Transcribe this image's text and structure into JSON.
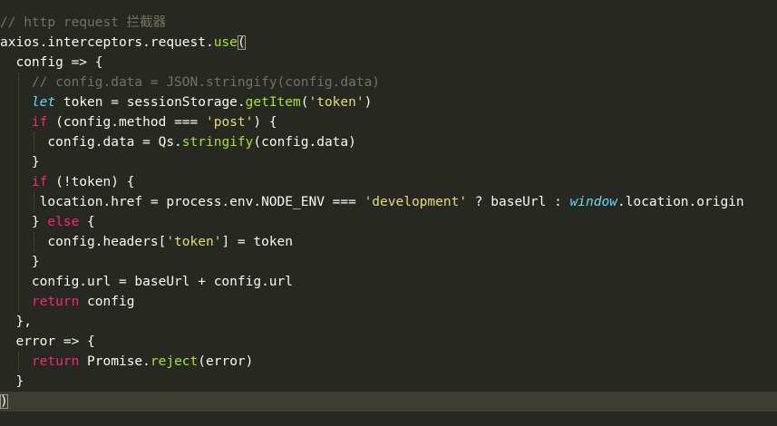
{
  "editor": {
    "lines": [
      [
        {
          "t": "// http request 拦截器",
          "c": "comment"
        }
      ],
      [
        {
          "t": "axios.interceptors.request.",
          "c": "text"
        },
        {
          "t": "use",
          "c": "fn"
        },
        {
          "t": "(",
          "c": "bracket"
        }
      ],
      [
        {
          "t": "  config => {",
          "c": "text"
        }
      ],
      [
        {
          "t": "    ",
          "c": "text"
        },
        {
          "t": "// config.data = JSON.stringify(config.data)",
          "c": "comment"
        }
      ],
      [
        {
          "t": "    ",
          "c": "text"
        },
        {
          "t": "let",
          "c": "italic"
        },
        {
          "t": " token = sessionStorage.",
          "c": "text"
        },
        {
          "t": "getItem",
          "c": "fn"
        },
        {
          "t": "(",
          "c": "text"
        },
        {
          "t": "'token'",
          "c": "string"
        },
        {
          "t": ")",
          "c": "text"
        }
      ],
      [
        {
          "t": "    ",
          "c": "text"
        },
        {
          "t": "if",
          "c": "keyword"
        },
        {
          "t": " (config.method === ",
          "c": "text"
        },
        {
          "t": "'post'",
          "c": "string"
        },
        {
          "t": ") {",
          "c": "text"
        }
      ],
      [
        {
          "t": "      config.data = Qs.",
          "c": "text"
        },
        {
          "t": "stringify",
          "c": "fn"
        },
        {
          "t": "(config.data)",
          "c": "text"
        }
      ],
      [
        {
          "t": "    }",
          "c": "text"
        }
      ],
      [
        {
          "t": "    ",
          "c": "text"
        },
        {
          "t": "if",
          "c": "keyword"
        },
        {
          "t": " (!token) {",
          "c": "text"
        }
      ],
      [
        {
          "t": "     location.href = process.env.NODE_ENV === ",
          "c": "text"
        },
        {
          "t": "'development'",
          "c": "string"
        },
        {
          "t": " ? baseUrl : ",
          "c": "text"
        },
        {
          "t": "window",
          "c": "italic"
        },
        {
          "t": ".location.origin",
          "c": "text"
        }
      ],
      [
        {
          "t": "    } ",
          "c": "text"
        },
        {
          "t": "else",
          "c": "keyword"
        },
        {
          "t": " {",
          "c": "text"
        }
      ],
      [
        {
          "t": "      config.headers[",
          "c": "text"
        },
        {
          "t": "'token'",
          "c": "string"
        },
        {
          "t": "] = token",
          "c": "text"
        }
      ],
      [
        {
          "t": "    }",
          "c": "text"
        }
      ],
      [
        {
          "t": "    config.url = baseUrl + config.url",
          "c": "text"
        }
      ],
      [
        {
          "t": "    ",
          "c": "text"
        },
        {
          "t": "return",
          "c": "keyword"
        },
        {
          "t": " config",
          "c": "text"
        }
      ],
      [
        {
          "t": "  },",
          "c": "text"
        }
      ],
      [
        {
          "t": "  error => {",
          "c": "text"
        }
      ],
      [
        {
          "t": "    ",
          "c": "text"
        },
        {
          "t": "return",
          "c": "keyword"
        },
        {
          "t": " Promise.",
          "c": "text"
        },
        {
          "t": "reject",
          "c": "fn"
        },
        {
          "t": "(error)",
          "c": "text"
        }
      ],
      [
        {
          "t": "  }",
          "c": "text"
        }
      ],
      [
        {
          "t": ")",
          "c": "bracket"
        }
      ]
    ],
    "active_line": 20,
    "colors": {
      "background": "#272822",
      "active_line": "#3e3d32",
      "comment": "#75715e",
      "keyword": "#f92672",
      "function": "#a6e22e",
      "string": "#e6db74",
      "storage": "#66d9ef",
      "text": "#f8f8f2"
    }
  }
}
